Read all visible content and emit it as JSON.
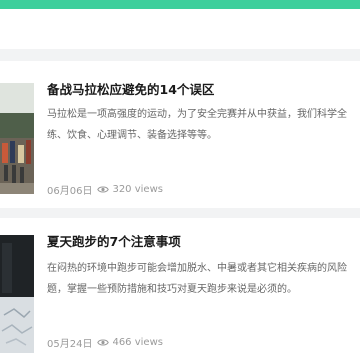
{
  "colors": {
    "accent": "#3ecf9c",
    "background": "#f2f3f4"
  },
  "articles": [
    {
      "title": "备战马拉松应避免的14个误区",
      "excerpt_lines": [
        "马拉松是一项高强度的运动，为了安全完赛并从中获益，我们科学全",
        "练、饮食、心理调节、装备选择等等。"
      ],
      "date": "06月06日",
      "views": "320 views",
      "icon": "eye-icon"
    },
    {
      "title": "夏天跑步的7个注意事项",
      "excerpt_lines": [
        "在闷热的环境中跑步可能会增加脱水、中暑或者其它相关疾病的风险",
        "题，掌握一些预防措施和技巧对夏天跑步来说是必须的。"
      ],
      "date": "05月24日",
      "views": "466 views",
      "icon": "eye-icon"
    }
  ]
}
